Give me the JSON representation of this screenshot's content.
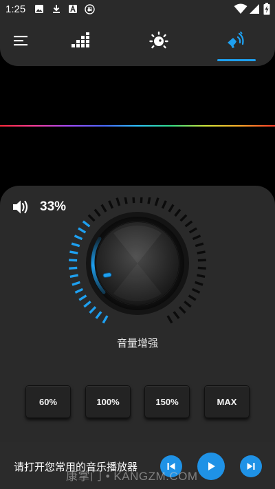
{
  "status_bar": {
    "time": "1:25",
    "left_icons": [
      "image-icon",
      "download-icon",
      "text-a-icon",
      "grid-circle-icon"
    ],
    "right_icons": [
      "wifi-icon",
      "signal-icon",
      "battery-charging-icon"
    ]
  },
  "nav": {
    "tabs": [
      {
        "icon": "menu-icon"
      },
      {
        "icon": "equalizer-icon"
      },
      {
        "icon": "brightness-icon"
      },
      {
        "icon": "speaker-boost-icon",
        "active": true
      }
    ],
    "accent_color": "#1ea0f0"
  },
  "volume": {
    "percent_label": "33%",
    "percent_value": 33,
    "knob_label": "音量增强"
  },
  "presets": [
    "60%",
    "100%",
    "150%",
    "MAX"
  ],
  "player": {
    "prompt": "请打开您常用的音乐播放器",
    "controls": [
      "previous-icon",
      "play-icon",
      "next-icon"
    ]
  },
  "watermark": "康掌门 • KANGZM.COM"
}
